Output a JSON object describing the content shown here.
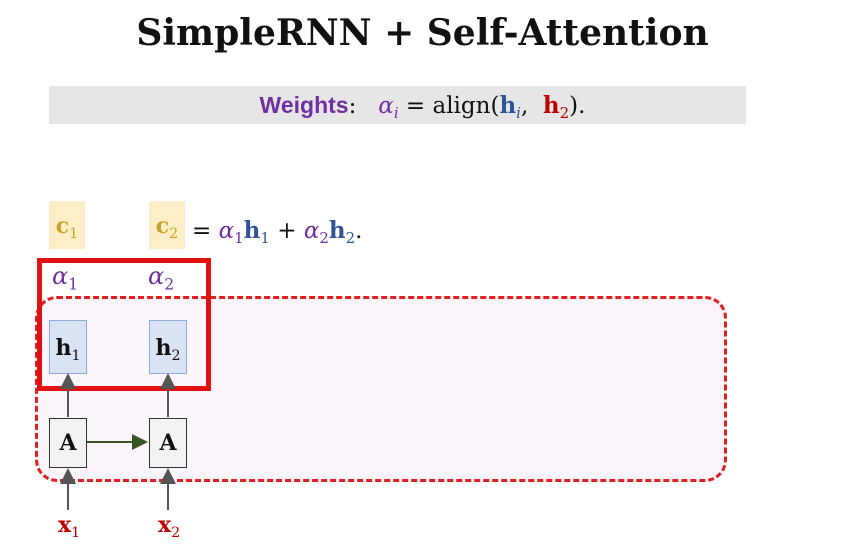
{
  "title": "SimpleRNN + Self-Attention",
  "weights_formula": {
    "label": "Weights",
    "colon": ":",
    "alpha": "α",
    "alpha_sub": "i",
    "eq_align": "= align(",
    "h": "h",
    "h_sub_i": "i",
    "comma": ",",
    "h_sub_2": "2",
    "close": ")."
  },
  "context": {
    "c1": "c",
    "c1_sub": "1",
    "c2": "c",
    "c2_sub": "2",
    "eq": "=",
    "alpha1": "α",
    "alpha1_sub": "1",
    "h1": "h",
    "h1_sub": "1",
    "plus": "+",
    "alpha2": "α",
    "alpha2_sub": "2",
    "h2": "h",
    "h2_sub": "2",
    "end": "."
  },
  "alpha_labels": [
    {
      "sym": "α",
      "sub": "1"
    },
    {
      "sym": "α",
      "sub": "2"
    }
  ],
  "hidden_states": [
    {
      "sym": "h",
      "sub": "1"
    },
    {
      "sym": "h",
      "sub": "2"
    }
  ],
  "cells": [
    {
      "label": "A"
    },
    {
      "label": "A"
    }
  ],
  "inputs": [
    {
      "sym": "x",
      "sub": "1"
    },
    {
      "sym": "x",
      "sub": "2"
    }
  ],
  "colors": {
    "purple": "#7030a0",
    "blue": "#2f5597",
    "red": "#c00000",
    "gold": "#c9a227",
    "arrow_green": "#375623"
  }
}
